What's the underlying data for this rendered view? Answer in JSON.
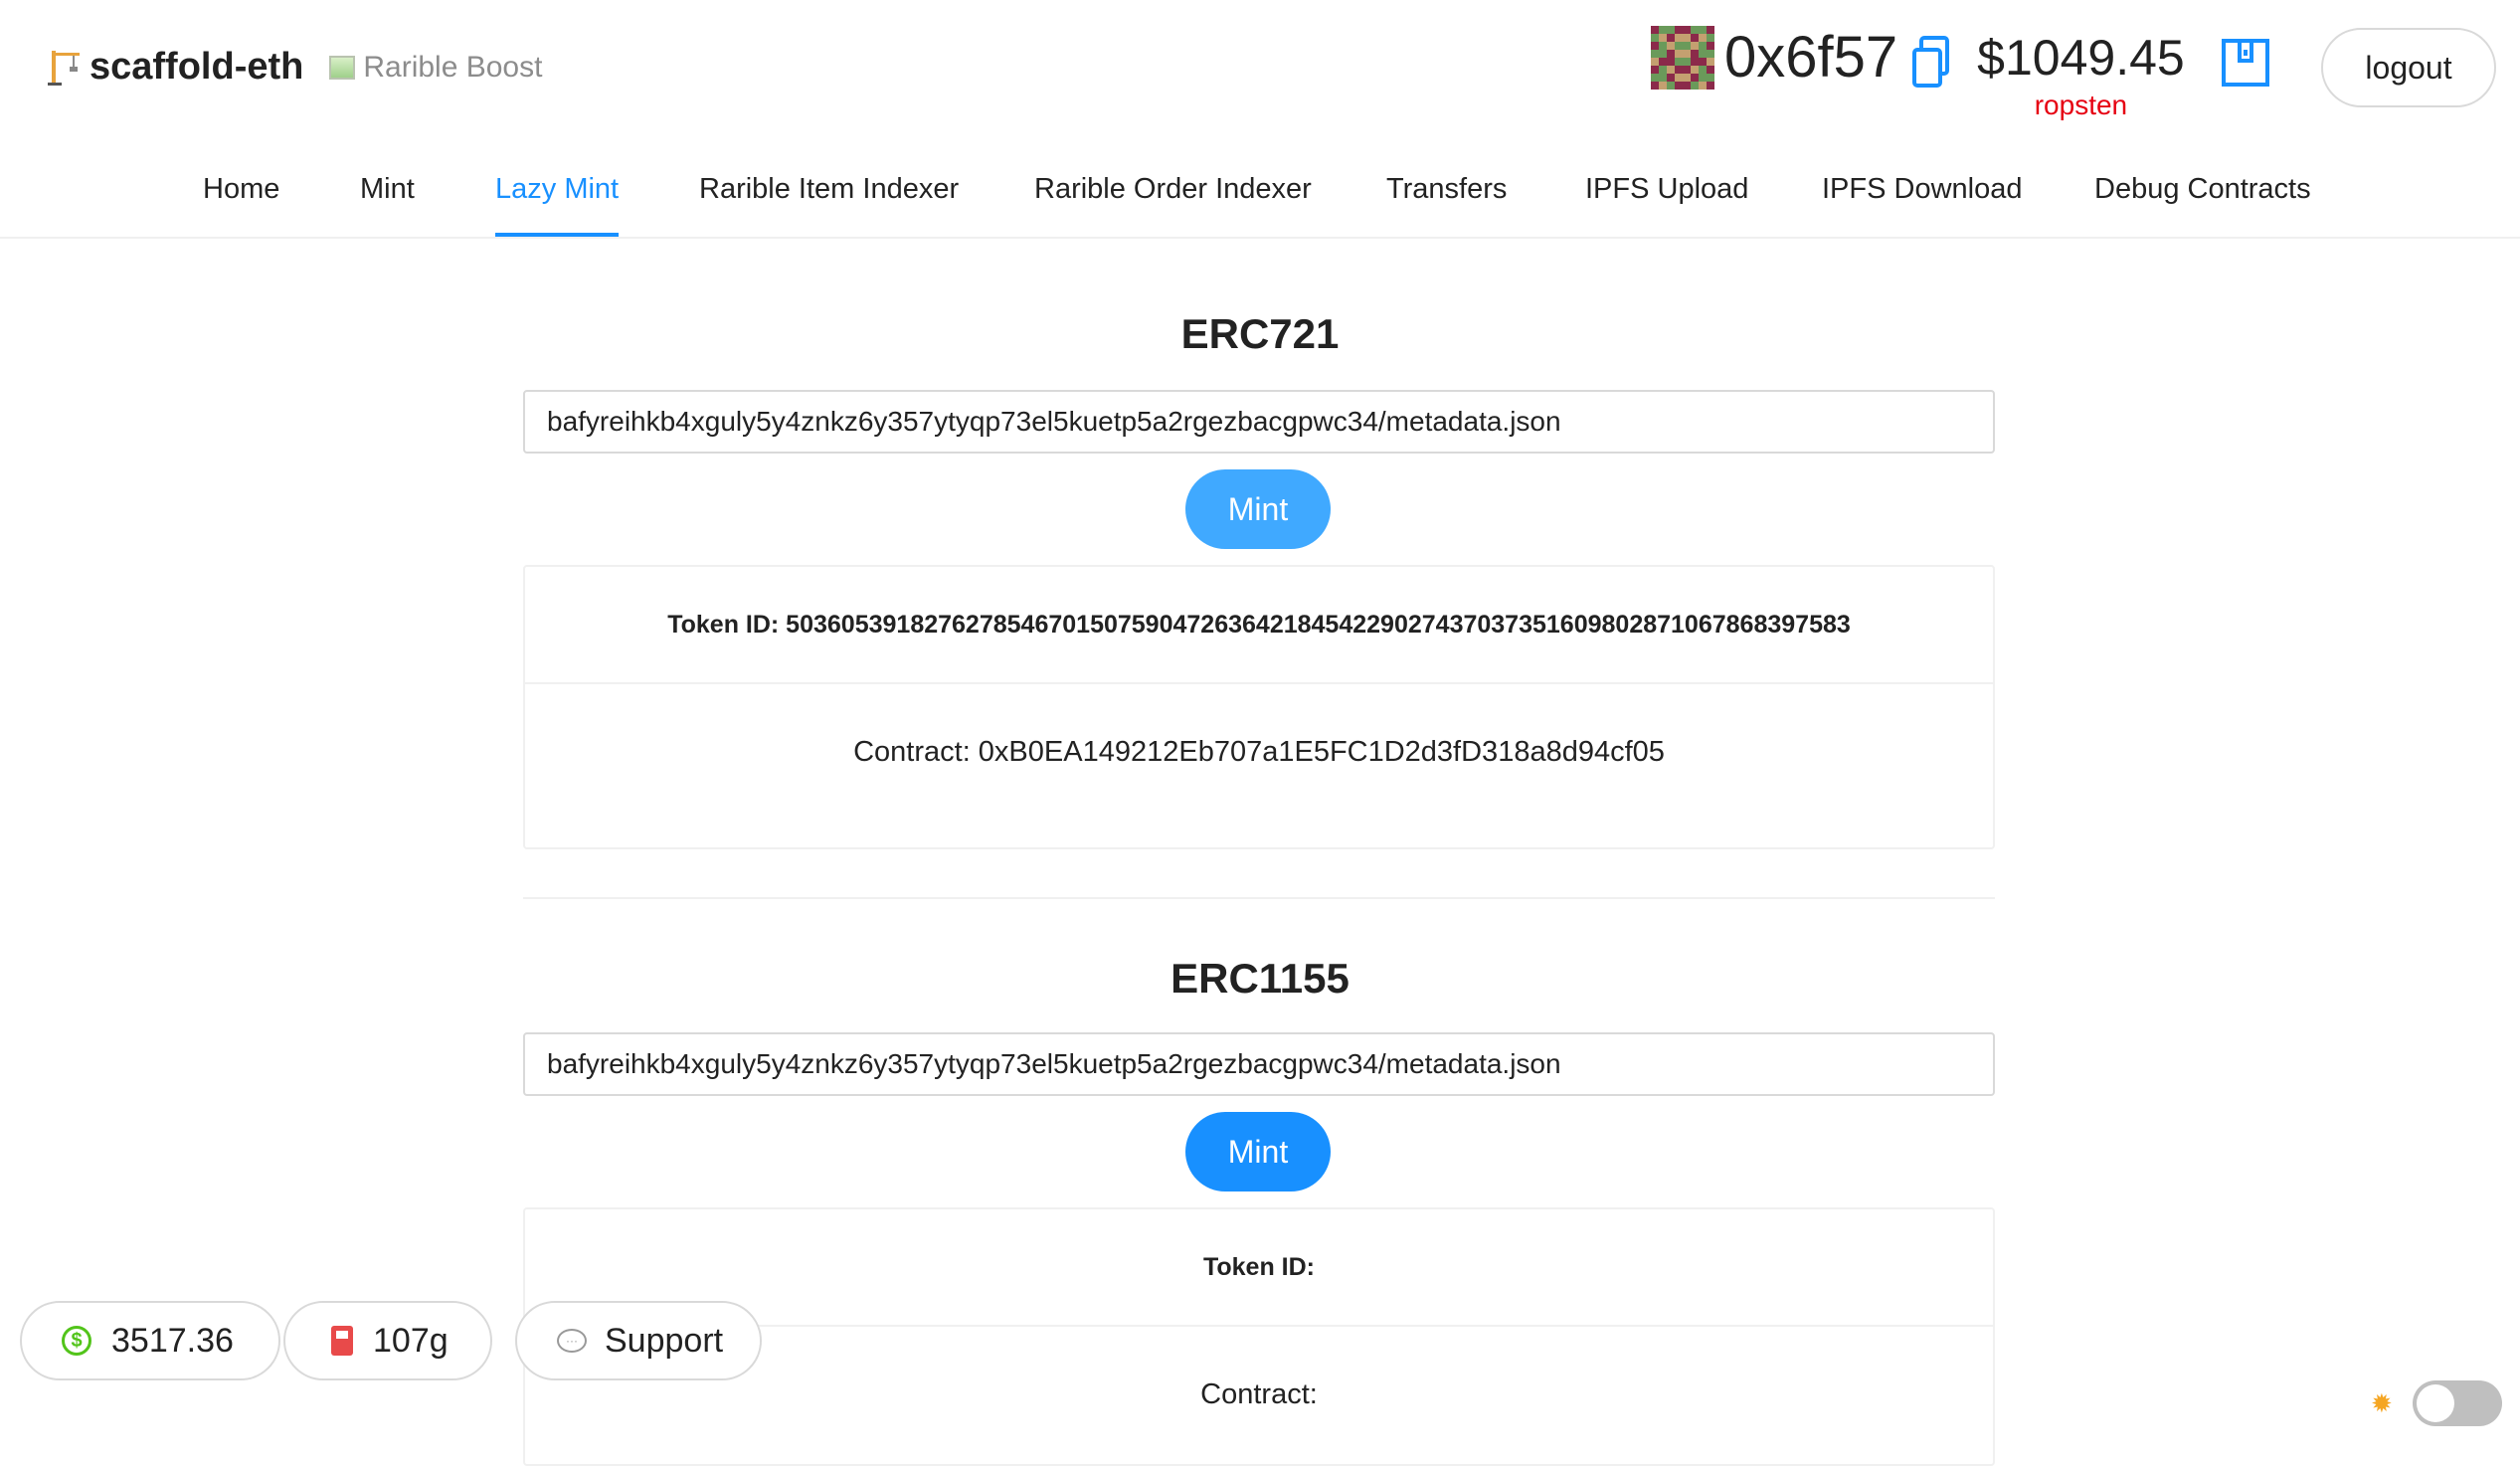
{
  "header": {
    "app_title": "scaffold-eth",
    "subtitle": "Rarible Boost",
    "address": "0x6f57",
    "balance": "$1049.45",
    "network": "ropsten",
    "logout_label": "logout"
  },
  "nav": {
    "items": [
      {
        "label": "Home"
      },
      {
        "label": "Mint"
      },
      {
        "label": "Lazy Mint"
      },
      {
        "label": "Rarible Item Indexer"
      },
      {
        "label": "Rarible Order Indexer"
      },
      {
        "label": "Transfers"
      },
      {
        "label": "IPFS Upload"
      },
      {
        "label": "IPFS Download"
      },
      {
        "label": "Debug Contracts"
      }
    ],
    "active": "Lazy Mint"
  },
  "erc721": {
    "title": "ERC721",
    "uri_value": "bafyreihkb4xguly5y4znkz6y357ytyqp73el5kuetp5a2rgezbacgpwc34/metadata.json",
    "mint_label": "Mint",
    "token_id_text": "Token ID: 50360539182762785467015075904726364218454229027437037351609802871067868397583",
    "contract_text": "Contract: 0xB0EA149212Eb707a1E5FC1D2d3fD318a8d94cf05"
  },
  "erc1155": {
    "title": "ERC1155",
    "uri_value": "bafyreihkb4xguly5y4znkz6y357ytyqp73el5kuetp5a2rgezbacgpwc34/metadata.json",
    "mint_label": "Mint",
    "token_id_text": "Token ID:",
    "contract_text": "Contract:"
  },
  "footer": {
    "price": "3517.36",
    "gas": "107g",
    "support_label": "Support"
  },
  "colors": {
    "accent": "#1890ff",
    "network": "#e60012",
    "price_icon": "#52c41a"
  },
  "icons": {
    "brand": "construction-crane-icon",
    "subtitle": "framed-picture-icon",
    "copy": "copy-icon",
    "wallet": "wallet-icon",
    "price": "dollar-icon",
    "gas": "fuel-pump-icon",
    "support": "speech-bubble-icon",
    "theme": "sun-icon"
  }
}
